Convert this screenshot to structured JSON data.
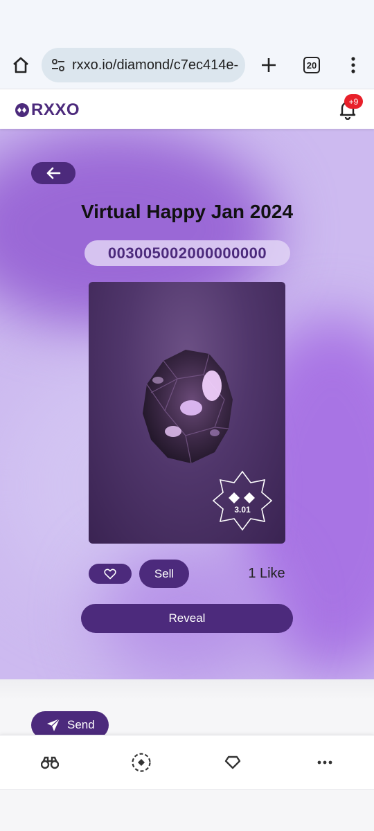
{
  "browser": {
    "url": "rxxo.io/diamond/c7ec414e-",
    "tab_count": "20",
    "icons": [
      "home-icon",
      "site-settings-icon",
      "new-tab-icon",
      "tab-switcher",
      "more-vert-icon"
    ]
  },
  "header": {
    "logo_text": "RXXO",
    "notification_badge": "+9"
  },
  "hero": {
    "title": "Virtual Happy Jan 2024",
    "diamond_id": "003005002000000000",
    "carat": "3.01",
    "sell_label": "Sell",
    "likes_label": "1 Like",
    "reveal_label": "Reveal"
  },
  "actions": {
    "send_label": "Send"
  },
  "bottom_nav": {
    "items": [
      "binoculars-icon",
      "scan-target-icon",
      "diamond-icon",
      "more-horiz-icon"
    ]
  },
  "colors": {
    "brand": "#4c2a7c",
    "hero_background": "#cdbaf0",
    "badge": "#e8202a"
  }
}
